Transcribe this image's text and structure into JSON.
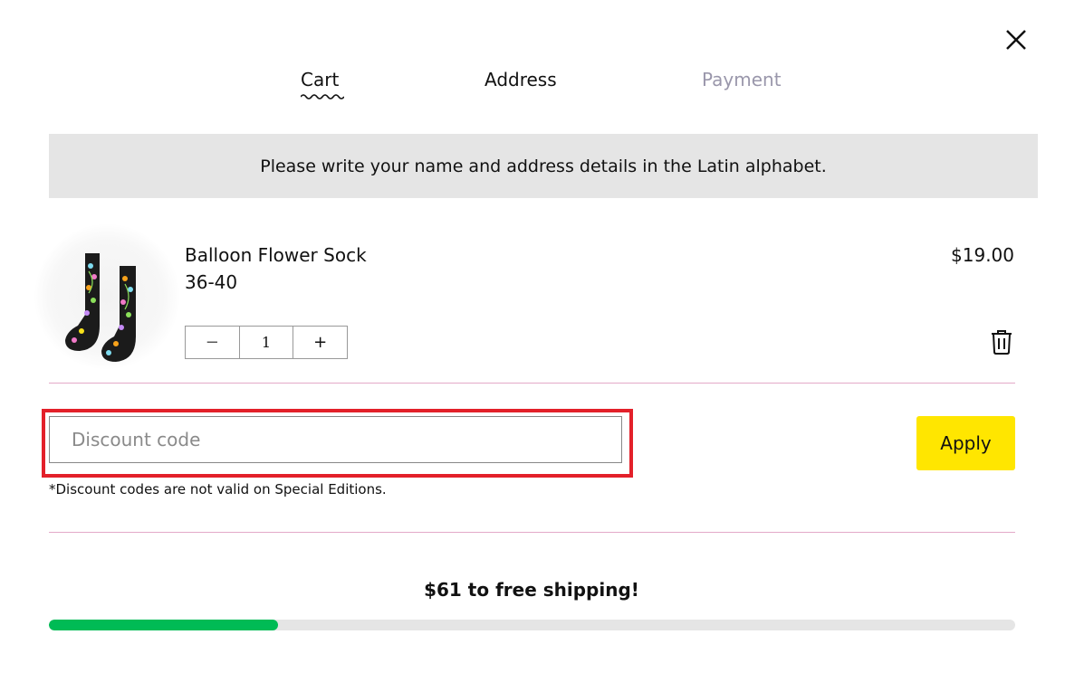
{
  "header": {
    "close_icon": "close-icon",
    "steps": [
      {
        "label": "Cart",
        "state": "active"
      },
      {
        "label": "Address",
        "state": "default"
      },
      {
        "label": "Payment",
        "state": "disabled"
      }
    ]
  },
  "notice": {
    "text": "Please write your name and address details in the Latin alphabet."
  },
  "cart": {
    "items": [
      {
        "name": "Balloon Flower Sock",
        "size": "36-40",
        "price": "$19.00",
        "quantity": "1",
        "decrease_label": "−",
        "increase_label": "+",
        "image": "sock-product-image",
        "remove_icon": "trash-icon"
      }
    ]
  },
  "discount": {
    "placeholder": "Discount code",
    "value": "",
    "apply_label": "Apply",
    "note": "*Discount codes are not valid on Special Editions."
  },
  "shipping": {
    "text": "$61 to free shipping!",
    "progress_fraction": 0.237,
    "fill_color": "#00bb55",
    "track_color": "#e5e5e5"
  },
  "colors": {
    "accent": "#ffe600",
    "highlight_border": "#e3202a",
    "divider": "#e3a9c8",
    "muted_step": "#9a97ab"
  }
}
